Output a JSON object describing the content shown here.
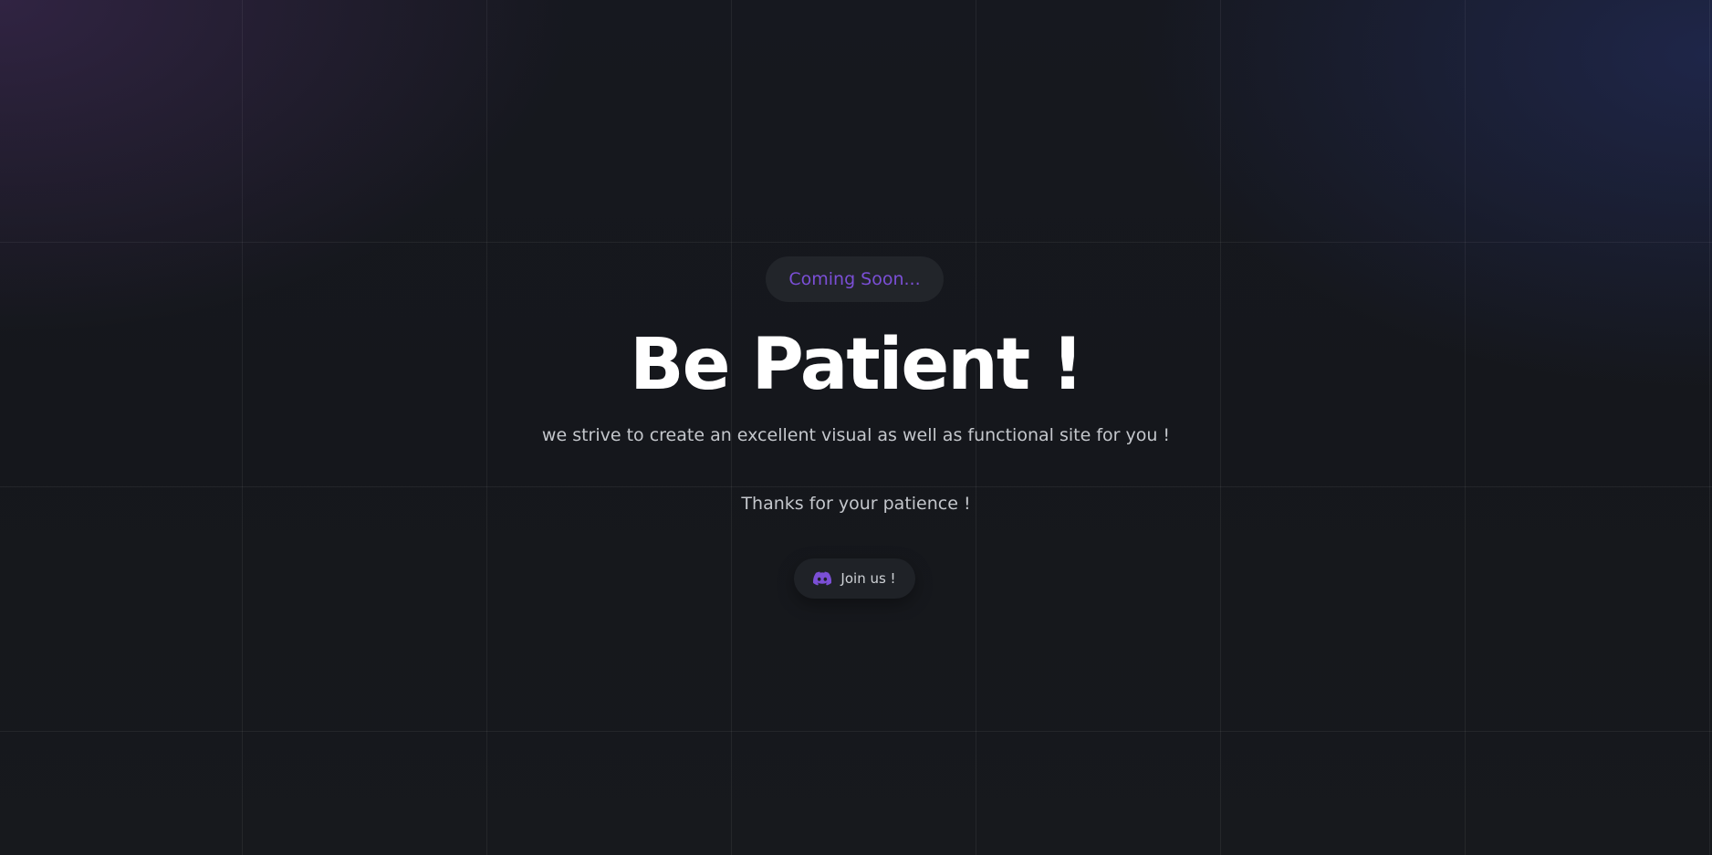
{
  "page": {
    "badge_text": "Coming Soon...",
    "title": "Be Patient !",
    "subtitle": "we strive to create an excellent visual as well as functional site for you !",
    "thanks": "Thanks for your patience !",
    "join_button": {
      "label": "Join us !",
      "icon": "discord-icon"
    }
  },
  "colors": {
    "background": "#14161b",
    "accent": "#7b4fd6",
    "title": "#ffffff",
    "body_text": "#c4c7cc",
    "pill_background": "#22252a"
  }
}
